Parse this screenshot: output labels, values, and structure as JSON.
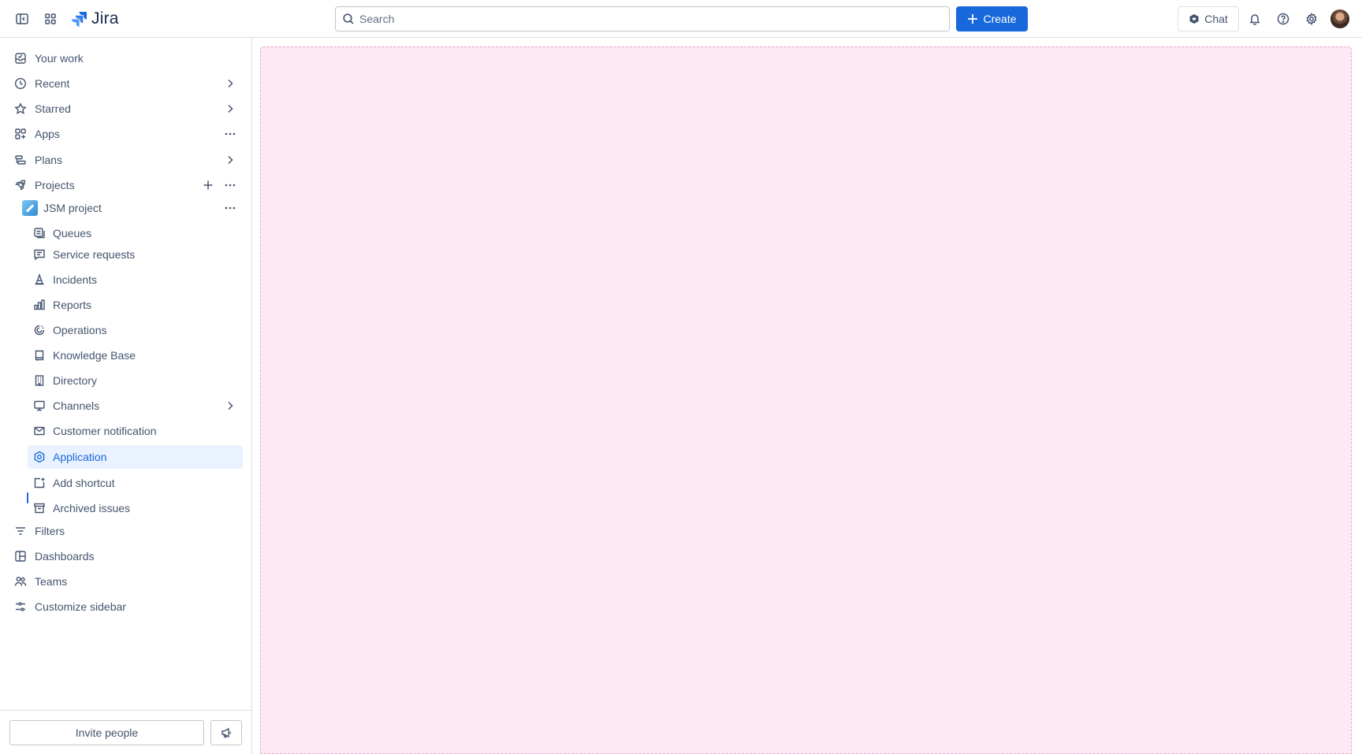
{
  "app": {
    "name": "Jira"
  },
  "topbar": {
    "search_placeholder": "Search",
    "create_label": "Create",
    "chat_label": "Chat",
    "icons": [
      "sidebar-toggle-icon",
      "app-switcher-icon",
      "jira-logo-icon",
      "search-icon",
      "plus-icon",
      "chat-bot-icon",
      "bell-icon",
      "help-icon",
      "gear-icon"
    ]
  },
  "sidebar": {
    "items": [
      {
        "label": "Your work",
        "icon": "inbox-icon"
      },
      {
        "label": "Recent",
        "icon": "clock-icon"
      },
      {
        "label": "Starred",
        "icon": "star-icon"
      },
      {
        "label": "Apps",
        "icon": "apps-icon"
      },
      {
        "label": "Plans",
        "icon": "plans-icon"
      },
      {
        "label": "Projects",
        "icon": "rocket-icon"
      },
      {
        "label": "JSM project",
        "icon": "project-avatar"
      },
      {
        "label": "Queues",
        "icon": "queues-icon"
      },
      {
        "label": "Service requests",
        "icon": "comment-icon"
      },
      {
        "label": "Incidents",
        "icon": "cone-icon"
      },
      {
        "label": "Reports",
        "icon": "chart-icon"
      },
      {
        "label": "Operations",
        "icon": "operations-icon"
      },
      {
        "label": "Knowledge Base",
        "icon": "book-icon"
      },
      {
        "label": "Directory",
        "icon": "building-icon"
      },
      {
        "label": "Channels",
        "icon": "monitor-icon"
      },
      {
        "label": "Customer notification",
        "icon": "envelope-icon"
      },
      {
        "label": "Application",
        "icon": "hexagon-gear-icon"
      },
      {
        "label": "Add shortcut",
        "icon": "add-shortcut-icon"
      },
      {
        "label": "Archived issues",
        "icon": "archive-icon"
      },
      {
        "label": "Filters",
        "icon": "filter-icon"
      },
      {
        "label": "Dashboards",
        "icon": "dashboard-icon"
      },
      {
        "label": "Teams",
        "icon": "people-icon"
      },
      {
        "label": "Customize sidebar",
        "icon": "sliders-icon"
      }
    ],
    "active_item": "Application",
    "footer": {
      "invite_label": "Invite people",
      "feedback_icon": "megaphone-icon"
    }
  },
  "colors": {
    "accent": "#1868db",
    "active_bg": "#e9f2fe",
    "canvas_bg": "#fde8f4",
    "text_subtle": "#44546f"
  }
}
